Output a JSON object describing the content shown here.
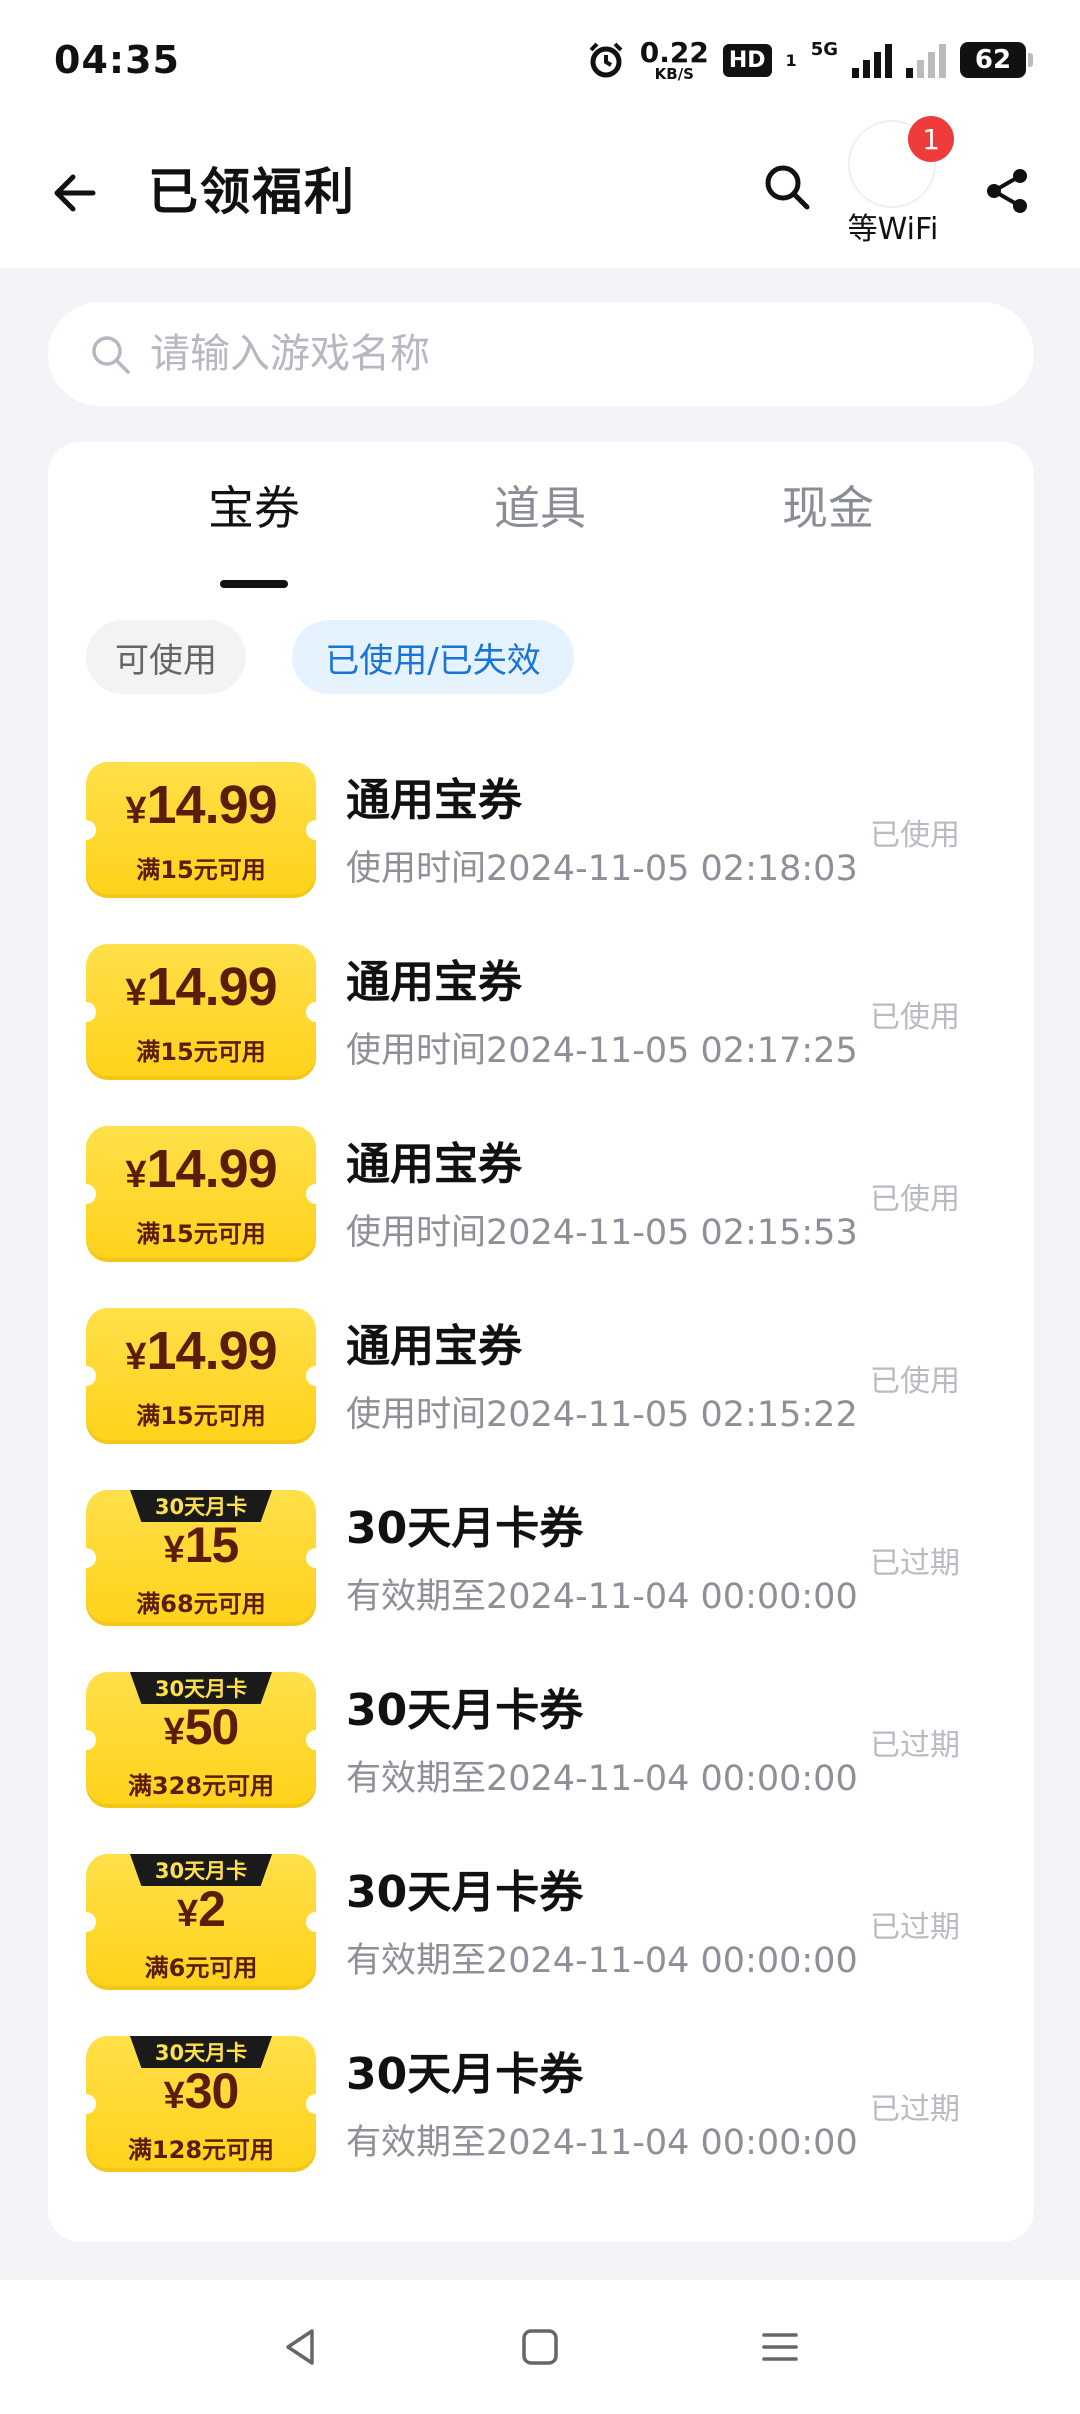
{
  "status_bar": {
    "time": "04:35",
    "net_speed": "0.22",
    "net_unit": "KB/S",
    "hd": "HD",
    "hd_sub": "1",
    "network_type": "5G",
    "battery": "62"
  },
  "header": {
    "title": "已领福利",
    "wifi_label": "等WiFi",
    "wifi_badge": "1",
    "icons": [
      "back-arrow-icon",
      "search-icon",
      "share-icon"
    ]
  },
  "search": {
    "placeholder": "请输入游戏名称"
  },
  "tabs": [
    {
      "label": "宝券",
      "active": true
    },
    {
      "label": "道具",
      "active": false
    },
    {
      "label": "现金",
      "active": false
    }
  ],
  "filters": [
    {
      "label": "可使用",
      "active": false
    },
    {
      "label": "已使用/已失效",
      "active": true
    }
  ],
  "coupons": [
    {
      "currency": "¥",
      "amount": "14.99",
      "condition": "满15元可用",
      "tag": "",
      "title": "通用宝券",
      "subtitle": "使用时间2024-11-05 02:18:03",
      "status": "已使用"
    },
    {
      "currency": "¥",
      "amount": "14.99",
      "condition": "满15元可用",
      "tag": "",
      "title": "通用宝券",
      "subtitle": "使用时间2024-11-05 02:17:25",
      "status": "已使用"
    },
    {
      "currency": "¥",
      "amount": "14.99",
      "condition": "满15元可用",
      "tag": "",
      "title": "通用宝券",
      "subtitle": "使用时间2024-11-05 02:15:53",
      "status": "已使用"
    },
    {
      "currency": "¥",
      "amount": "14.99",
      "condition": "满15元可用",
      "tag": "",
      "title": "通用宝券",
      "subtitle": "使用时间2024-11-05 02:15:22",
      "status": "已使用"
    },
    {
      "currency": "¥",
      "amount": "15",
      "condition": "满68元可用",
      "tag": "30天月卡",
      "title": "30天月卡券",
      "subtitle": "有效期至2024-11-04 00:00:00",
      "status": "已过期"
    },
    {
      "currency": "¥",
      "amount": "50",
      "condition": "满328元可用",
      "tag": "30天月卡",
      "title": "30天月卡券",
      "subtitle": "有效期至2024-11-04 00:00:00",
      "status": "已过期"
    },
    {
      "currency": "¥",
      "amount": "2",
      "condition": "满6元可用",
      "tag": "30天月卡",
      "title": "30天月卡券",
      "subtitle": "有效期至2024-11-04 00:00:00",
      "status": "已过期"
    },
    {
      "currency": "¥",
      "amount": "30",
      "condition": "满128元可用",
      "tag": "30天月卡",
      "title": "30天月卡券",
      "subtitle": "有效期至2024-11-04 00:00:00",
      "status": "已过期"
    }
  ],
  "nav": [
    "back-triangle-icon",
    "home-square-icon",
    "menu-lines-icon"
  ],
  "colors": {
    "coupon_yellow": "#ffd21a",
    "coupon_text": "#5a1d0a",
    "active_filter_bg": "#e5f2ff",
    "active_filter_text": "#1a74d6",
    "badge_red": "#ee3b3b"
  }
}
